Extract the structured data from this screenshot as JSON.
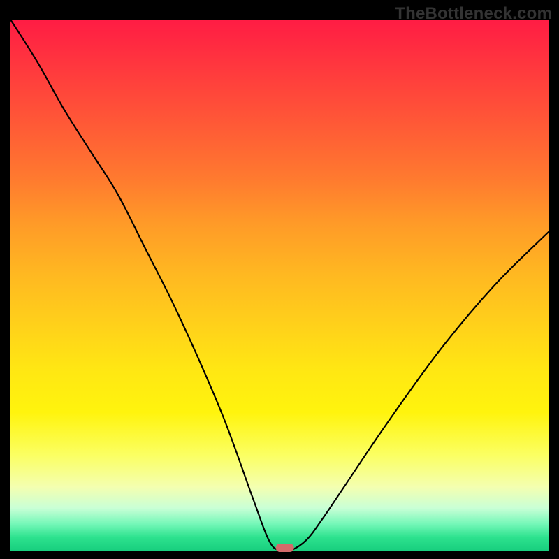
{
  "watermark": "TheBottleneck.com",
  "colors": {
    "frame_background": "#000000",
    "gradient_top": "#ff1c44",
    "gradient_mid": "#ffd21a",
    "gradient_bottom": "#18cf7e",
    "curve": "#000000",
    "marker": "#d46a6a"
  },
  "chart_data": {
    "type": "line",
    "title": "",
    "xlabel": "",
    "ylabel": "",
    "xlim": [
      0,
      100
    ],
    "ylim": [
      0,
      100
    ],
    "grid": false,
    "legend": false,
    "series": [
      {
        "name": "bottleneck-curve",
        "x": [
          0,
          5,
          10,
          15,
          20,
          25,
          30,
          35,
          40,
          45,
          48,
          50,
          52,
          55,
          58,
          62,
          70,
          80,
          90,
          100
        ],
        "y": [
          100,
          92,
          83,
          75,
          67,
          57,
          47,
          36,
          24,
          10,
          2,
          0,
          0,
          2,
          6,
          12,
          24,
          38,
          50,
          60
        ]
      }
    ],
    "marker": {
      "x": 51,
      "y": 0,
      "shape": "pill"
    }
  }
}
